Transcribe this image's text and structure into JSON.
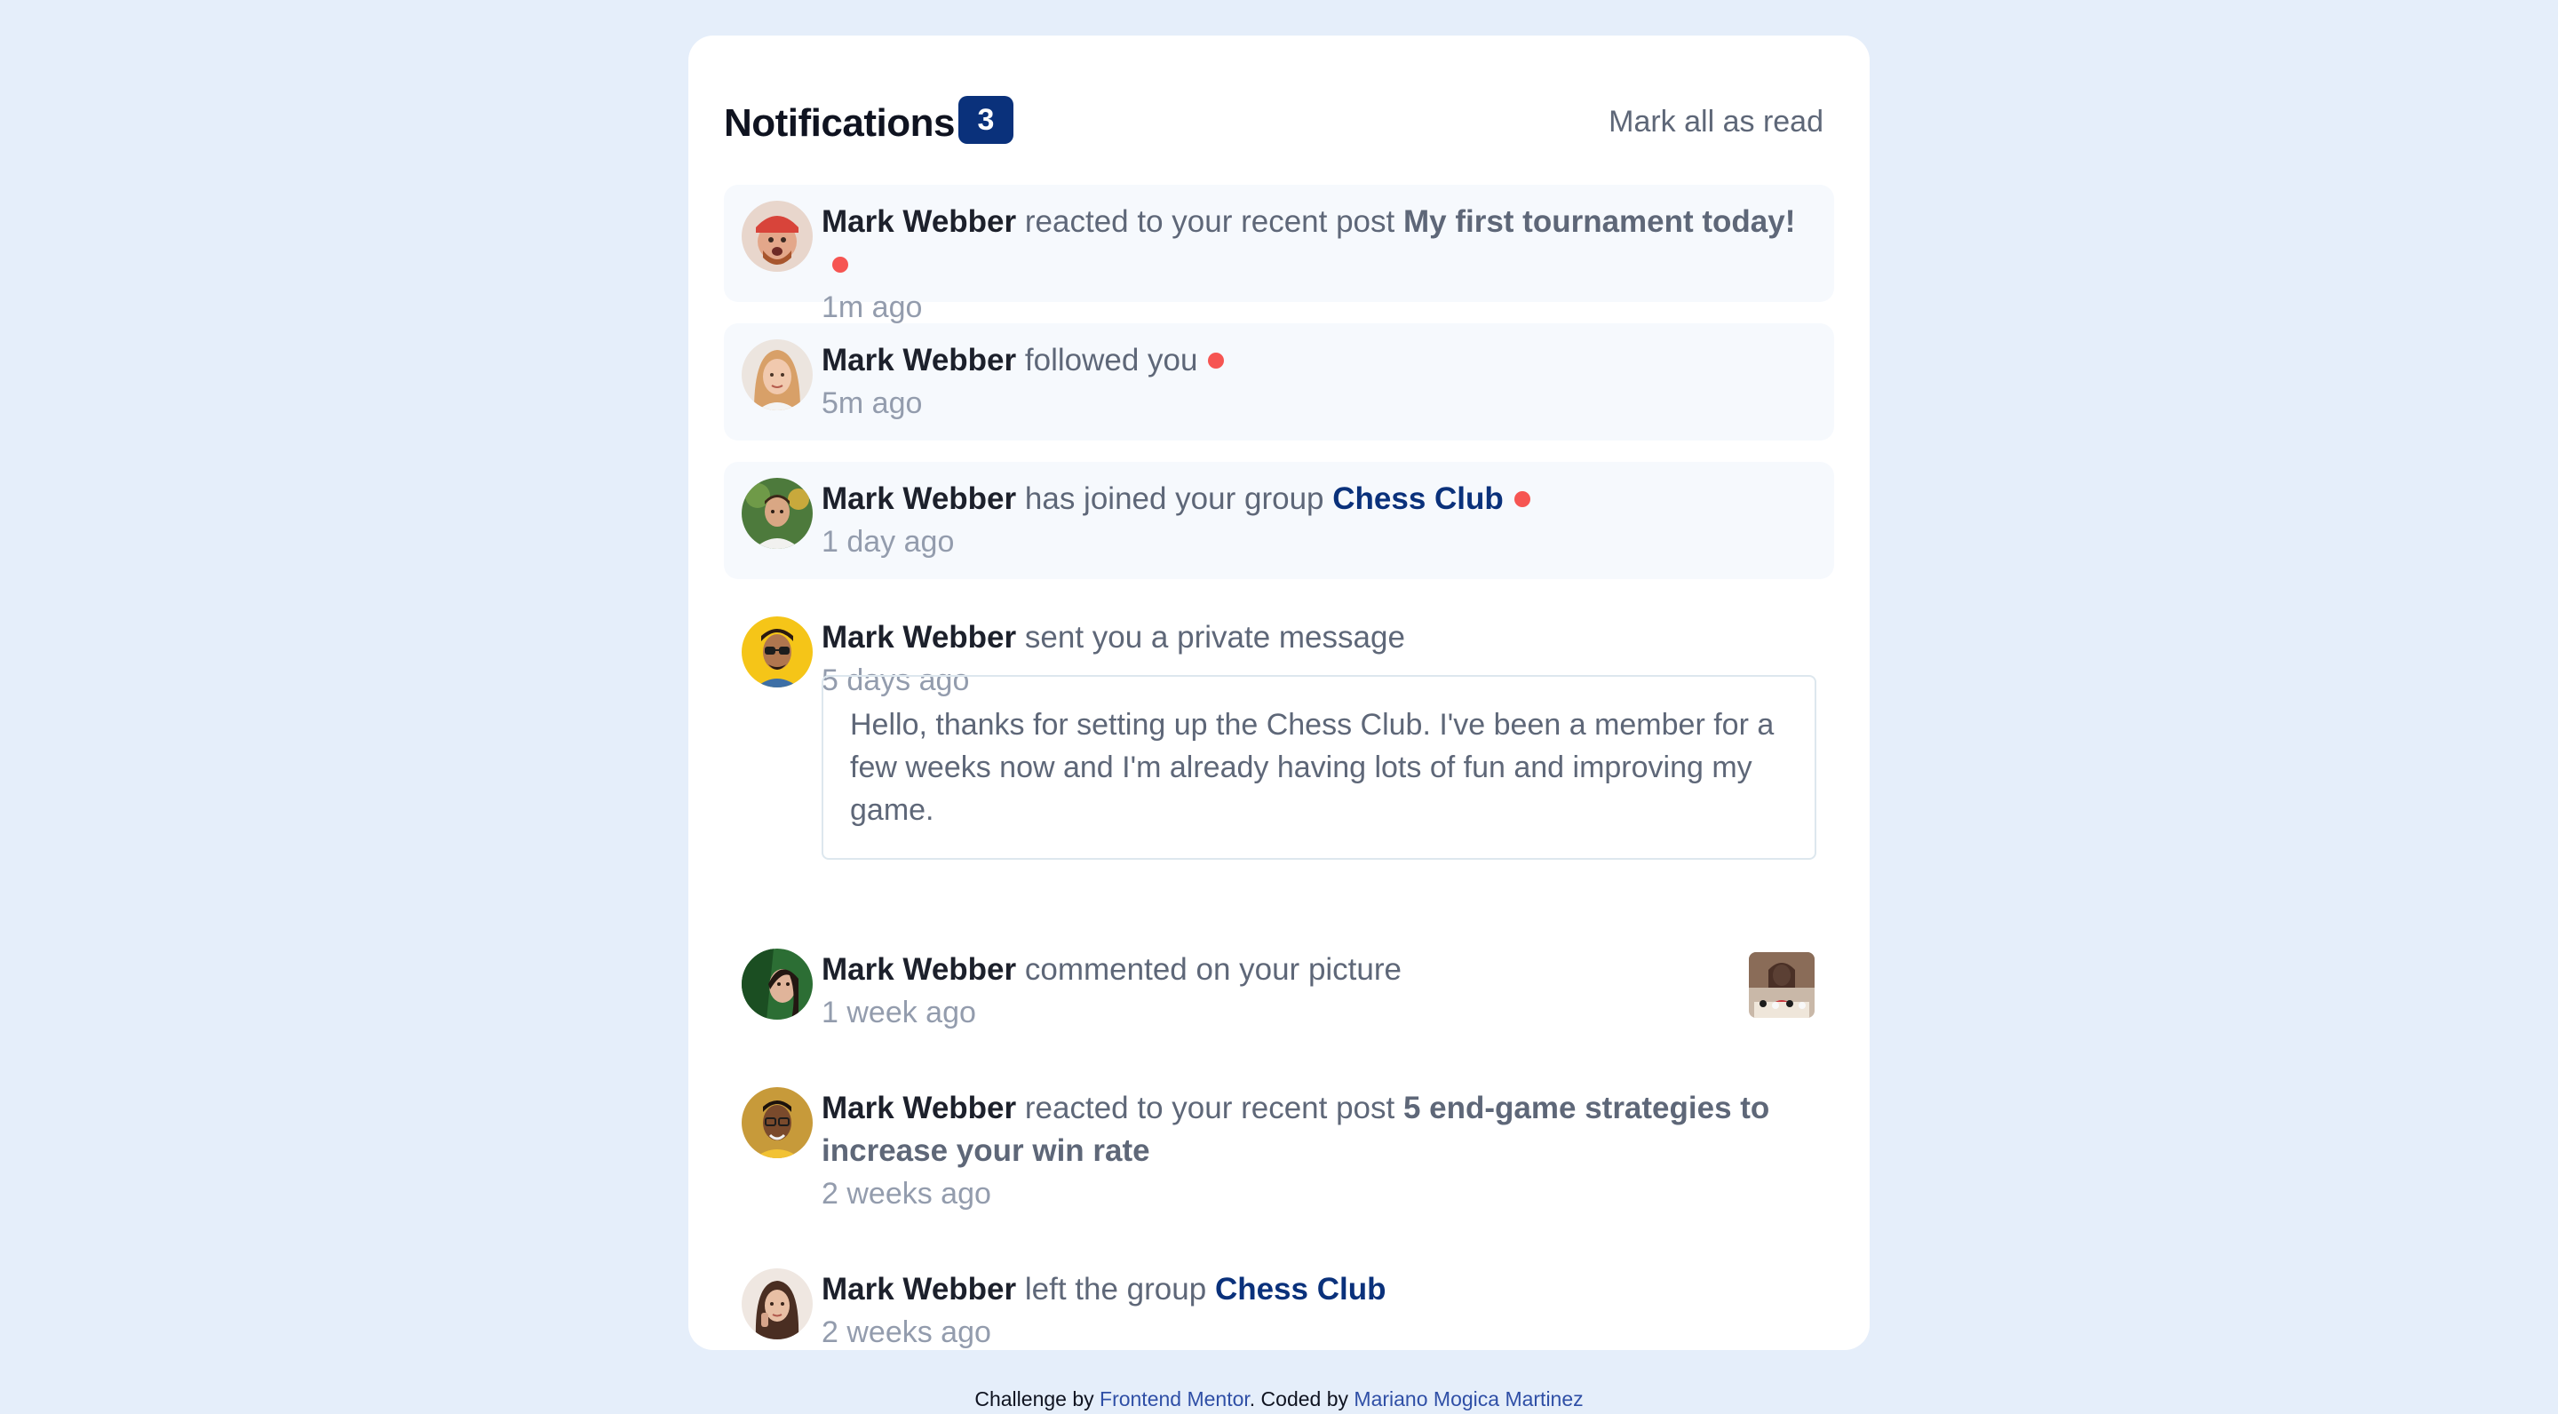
{
  "header": {
    "title": "Notifications",
    "unread_count": "3",
    "mark_all_label": "Mark all as read"
  },
  "notifications": [
    {
      "name": "Mark Webber",
      "action": "reacted to your recent post",
      "target": "My first tournament today!",
      "time": "1m ago",
      "unread": true
    },
    {
      "name": "Mark Webber",
      "action": "followed you",
      "target": "",
      "time": "5m ago",
      "unread": true
    },
    {
      "name": "Mark Webber",
      "action": "has joined your group",
      "target": "Chess Club",
      "time": "1 day ago",
      "unread": true
    },
    {
      "name": "Mark Webber",
      "action": "sent you a private message",
      "target": "",
      "time": "5 days ago",
      "unread": false,
      "message": "Hello, thanks for setting up the Chess Club. I've been a member for a few weeks now and I'm already having lots of fun and improving my game."
    },
    {
      "name": "Mark Webber",
      "action": "commented on your picture",
      "target": "",
      "time": "1 week ago",
      "unread": false
    },
    {
      "name": "Mark Webber",
      "action": "reacted to your recent post",
      "target": "5 end-game strategies to increase your win rate",
      "time": "2 weeks ago",
      "unread": false
    },
    {
      "name": "Mark Webber",
      "action": "left the group",
      "target": "Chess Club",
      "time": "2 weeks ago",
      "unread": false
    }
  ],
  "footer": {
    "challenge_by": "Challenge by",
    "frontend_mentor": "Frontend Mentor",
    "coded_by": ". Coded by",
    "author": "Mariano Mogica Martinez"
  },
  "colors": {
    "background": "#e5eefa",
    "badge": "#0a317b",
    "unread_dot": "#f65552",
    "unread_bg": "#f6f9fd"
  },
  "icons": [
    "avatar-mark-webber",
    "avatar-angela-gray",
    "avatar-jacob-thompson",
    "avatar-rizky-hasanuddin",
    "avatar-kimberly-smith",
    "avatar-nathan-peterson",
    "avatar-anna-kim",
    "chess-picture-thumbnail"
  ]
}
